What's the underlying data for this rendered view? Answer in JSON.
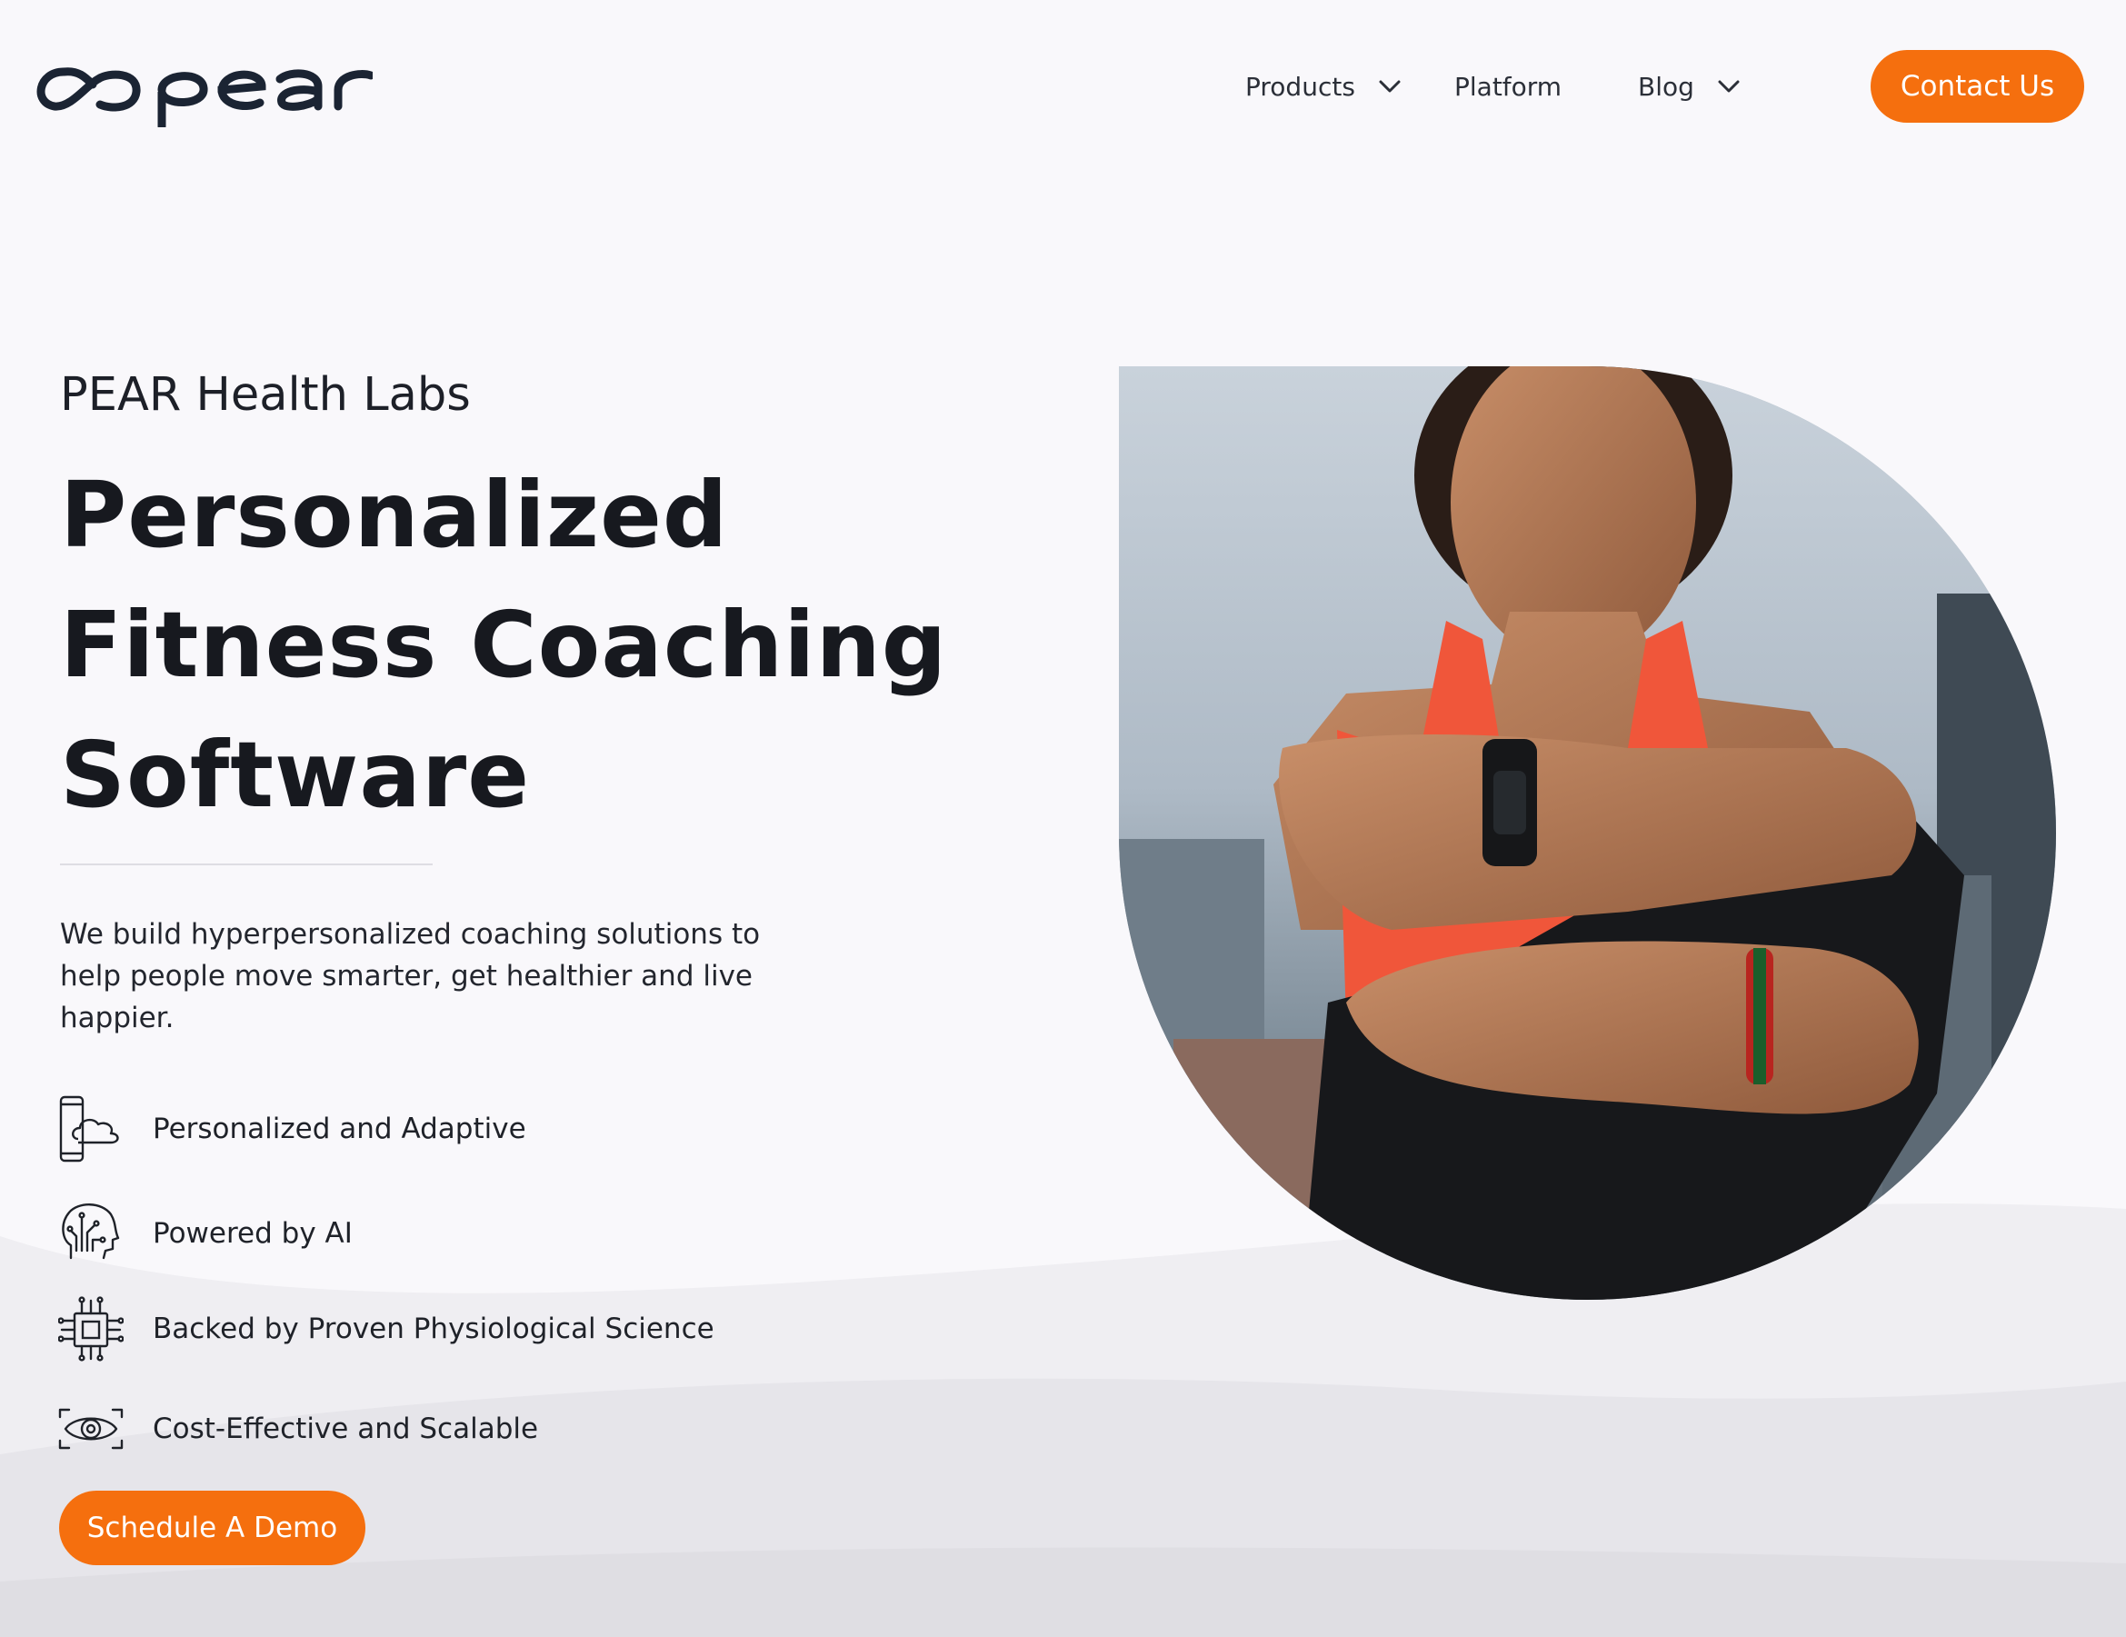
{
  "brand": {
    "logo_text": "pear",
    "logo_icon": "infinity-loop-icon"
  },
  "nav": {
    "items": [
      {
        "label": "Products",
        "has_dropdown": true
      },
      {
        "label": "Platform",
        "has_dropdown": false
      },
      {
        "label": "Blog",
        "has_dropdown": true
      }
    ],
    "cta_label": "Contact Us"
  },
  "hero": {
    "eyebrow": "PEAR Health Labs",
    "headline_lines": [
      "Personalized",
      "Fitness Coaching",
      "Software"
    ],
    "description": "We build hyperpersonalized coaching solutions to help people move smarter, get healthier and live happier.",
    "features": [
      {
        "icon": "phone-cloud-icon",
        "label": "Personalized and Adaptive"
      },
      {
        "icon": "ai-head-icon",
        "label": "Powered by AI"
      },
      {
        "icon": "microchip-icon",
        "label": "Backed by Proven Physiological Science"
      },
      {
        "icon": "eye-scan-icon",
        "label": "Cost-Effective and Scalable"
      }
    ],
    "cta_label": "Schedule A Demo",
    "image_subject": "woman-checking-smartwatch-photo"
  },
  "colors": {
    "accent": "#f56f0e",
    "text": "#17191f",
    "background": "#f9f8fb",
    "logo": "#1b2433"
  }
}
